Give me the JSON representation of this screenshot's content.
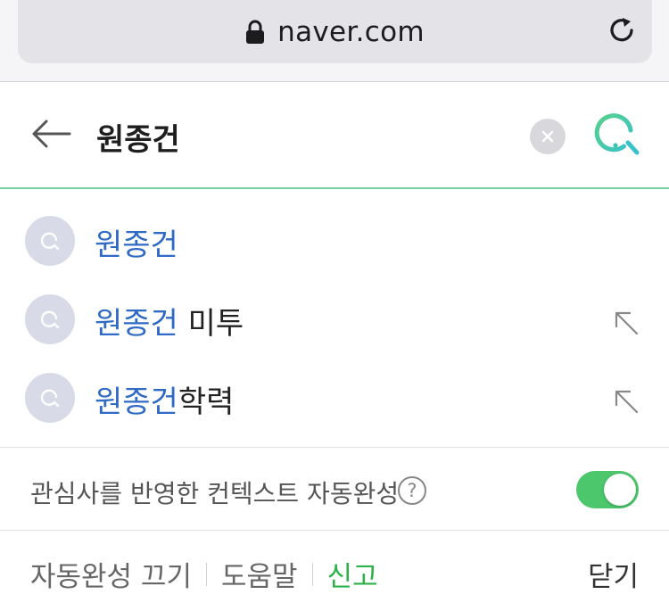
{
  "browser": {
    "url_text": "naver.com",
    "icons": {
      "lock": "lock-icon",
      "reload": "reload-icon"
    }
  },
  "search": {
    "query": "원종건",
    "icons": {
      "back": "back-arrow-icon",
      "clear": "clear-icon",
      "search": "search-icon"
    },
    "accent_color": "#77d39c"
  },
  "suggestions": [
    {
      "highlight": "원종건",
      "rest": "",
      "has_arrow": false
    },
    {
      "highlight": "원종건",
      "rest": " 미투",
      "has_arrow": true
    },
    {
      "highlight": "원종건",
      "rest": "학력",
      "has_arrow": true
    }
  ],
  "context_autocomplete": {
    "label": "관심사를 반영한 컨텍스트 자동완성",
    "help": "?",
    "toggle_on": true,
    "toggle_color": "#4cc76c"
  },
  "footer": {
    "disable_autocomplete": "자동완성 끄기",
    "help": "도움말",
    "report": "신고",
    "close": "닫기"
  },
  "colors": {
    "highlight_text": "#2f6ac5",
    "report_link": "#2db24a"
  }
}
